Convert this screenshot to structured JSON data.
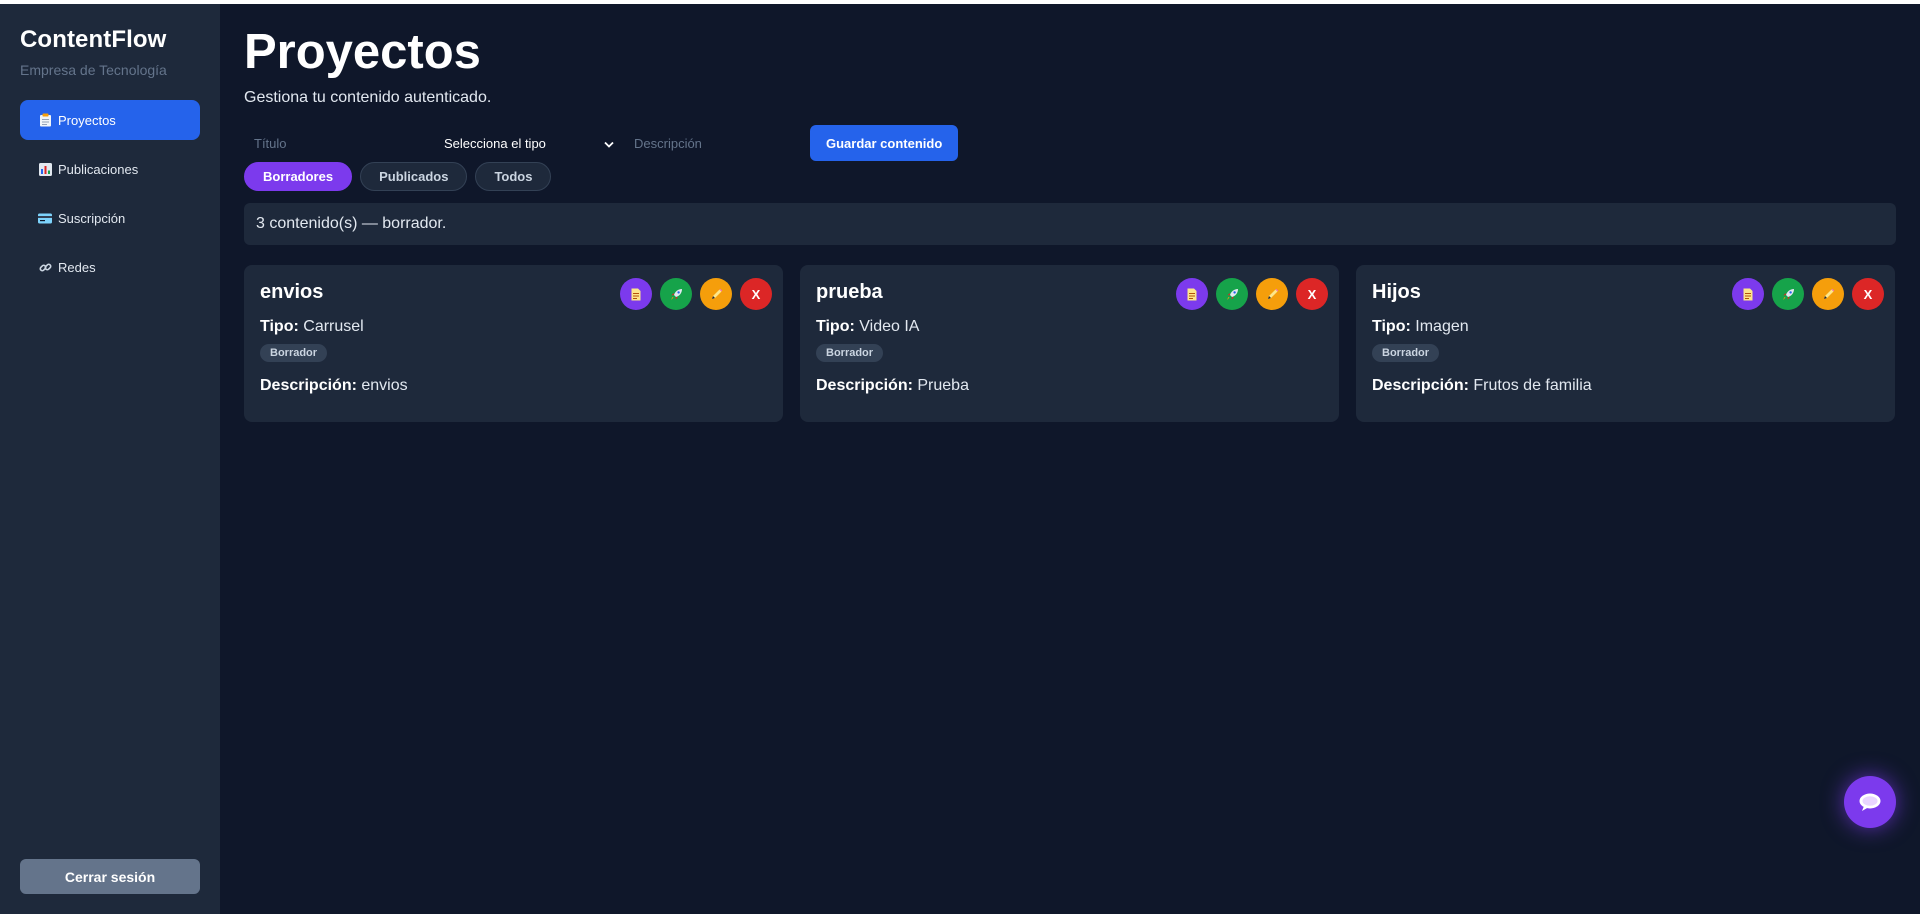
{
  "sidebar": {
    "brand": "ContentFlow",
    "company": "Empresa de Tecnología",
    "items": [
      {
        "label": "Proyectos",
        "icon": "clipboard-icon",
        "active": true
      },
      {
        "label": "Publicaciones",
        "icon": "bar-chart-icon",
        "active": false
      },
      {
        "label": "Suscripción",
        "icon": "credit-card-icon",
        "active": false
      },
      {
        "label": "Redes",
        "icon": "link-icon",
        "active": false
      }
    ],
    "logout_label": "Cerrar sesión"
  },
  "header": {
    "title": "Proyectos",
    "subtitle": "Gestiona tu contenido autenticado."
  },
  "form": {
    "title_placeholder": "Título",
    "type_selected": "Selecciona el tipo",
    "description_placeholder": "Descripción",
    "save_label": "Guardar contenido"
  },
  "tabs": [
    {
      "label": "Borradores",
      "active": true
    },
    {
      "label": "Publicados",
      "active": false
    },
    {
      "label": "Todos",
      "active": false
    }
  ],
  "summary": "3 contenido(s) — borrador.",
  "card_labels": {
    "type": "Tipo:",
    "description": "Descripción:",
    "delete": "X"
  },
  "cards": [
    {
      "title": "envios",
      "type": "Carrusel",
      "status": "Borrador",
      "description": "envios"
    },
    {
      "title": "prueba",
      "type": "Video IA",
      "status": "Borrador",
      "description": "Prueba"
    },
    {
      "title": "Hijos",
      "type": "Imagen",
      "status": "Borrador",
      "description": "Frutos de familia"
    }
  ],
  "colors": {
    "background": "#0f172a",
    "sidebar": "#1e293b",
    "primary": "#2563eb",
    "accent_purple": "#7c3aed",
    "green": "#16a34a",
    "orange": "#f59e0b",
    "red": "#dc2626"
  }
}
